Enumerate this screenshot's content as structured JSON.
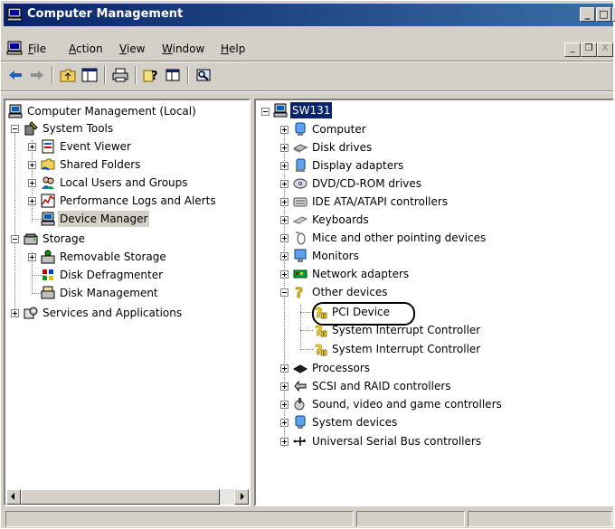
{
  "window": {
    "title": "Computer Management"
  },
  "titlebar_buttons": {
    "minimize": "_",
    "maximize": "□",
    "close": "x"
  },
  "menu": [
    {
      "label": "File",
      "key": "F",
      "rest": "ile"
    },
    {
      "label": "Action",
      "key": "A",
      "rest": "ction"
    },
    {
      "label": "View",
      "key": "V",
      "rest": "iew"
    },
    {
      "label": "Window",
      "key": "W",
      "rest": "indow"
    },
    {
      "label": "Help",
      "key": "H",
      "rest": "elp"
    }
  ],
  "mdi_buttons": {
    "minimize": "_",
    "restore": "❐",
    "close": "X"
  },
  "left_tree": {
    "root": "Computer Management (Local)",
    "system_tools": "System Tools",
    "event_viewer": "Event Viewer",
    "shared_folders": "Shared Folders",
    "local_users": "Local Users and Groups",
    "perf_logs": "Performance Logs and Alerts",
    "device_manager": "Device Manager",
    "storage": "Storage",
    "removable_storage": "Removable Storage",
    "disk_defrag": "Disk Defragmenter",
    "disk_mgmt": "Disk Management",
    "services": "Services and Applications"
  },
  "right_tree": {
    "root": "SW131",
    "categories": [
      {
        "label": "Computer",
        "icon": "computer-icon"
      },
      {
        "label": "Disk drives",
        "icon": "disk-drive-icon"
      },
      {
        "label": "Display adapters",
        "icon": "display-adapter-icon"
      },
      {
        "label": "DVD/CD-ROM drives",
        "icon": "cdrom-icon"
      },
      {
        "label": "IDE ATA/ATAPI controllers",
        "icon": "ide-controller-icon"
      },
      {
        "label": "Keyboards",
        "icon": "keyboard-icon"
      },
      {
        "label": "Mice and other pointing devices",
        "icon": "mouse-icon"
      },
      {
        "label": "Monitors",
        "icon": "monitor-icon"
      },
      {
        "label": "Network adapters",
        "icon": "network-adapter-icon"
      }
    ],
    "other_devices": "Other devices",
    "other_children": [
      "PCI Device",
      "System Interrupt Controller",
      "System Interrupt Controller"
    ],
    "categories_after": [
      {
        "label": "Processors",
        "icon": "processor-icon"
      },
      {
        "label": "SCSI and RAID controllers",
        "icon": "scsi-icon"
      },
      {
        "label": "Sound, video and game controllers",
        "icon": "sound-icon"
      },
      {
        "label": "System devices",
        "icon": "system-devices-icon"
      },
      {
        "label": "Universal Serial Bus controllers",
        "icon": "usb-icon"
      }
    ]
  },
  "colors": {
    "title_start": "#0a246a",
    "title_end": "#3a6ea5",
    "selection": "#0a246a",
    "face": "#d4d0c8",
    "warning": "#ffd700"
  }
}
